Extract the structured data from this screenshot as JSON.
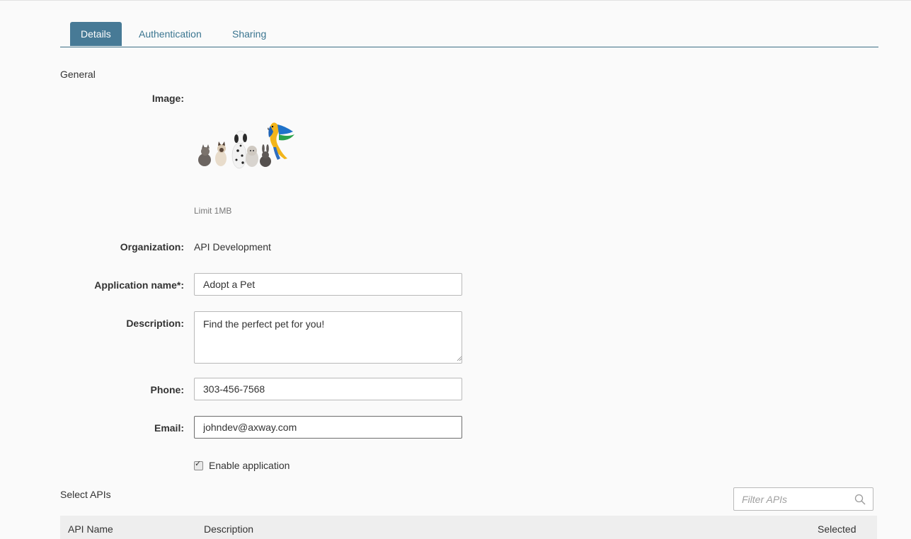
{
  "tabs": [
    {
      "label": "Details",
      "active": true
    },
    {
      "label": "Authentication",
      "active": false
    },
    {
      "label": "Sharing",
      "active": false
    }
  ],
  "general": {
    "section_title": "General",
    "image_label": "Image:",
    "image_hint": "Limit 1MB",
    "organization_label": "Organization:",
    "organization_value": "API Development",
    "app_name_label": "Application name*:",
    "app_name_value": "Adopt a Pet",
    "description_label": "Description:",
    "description_value": "Find the perfect pet for you!",
    "phone_label": "Phone:",
    "phone_value": "303-456-7568",
    "email_label": "Email:",
    "email_value": "johndev@axway.com",
    "enable_label": "Enable application",
    "enable_checked": true
  },
  "apis": {
    "section_title": "Select APIs",
    "filter_placeholder": "Filter APIs",
    "columns": [
      "API Name",
      "Description",
      "Selected"
    ]
  },
  "colors": {
    "accent": "#477a96",
    "tab_text": "#3a7590"
  },
  "icons": {
    "search": "search-icon",
    "image": "pets-image"
  }
}
